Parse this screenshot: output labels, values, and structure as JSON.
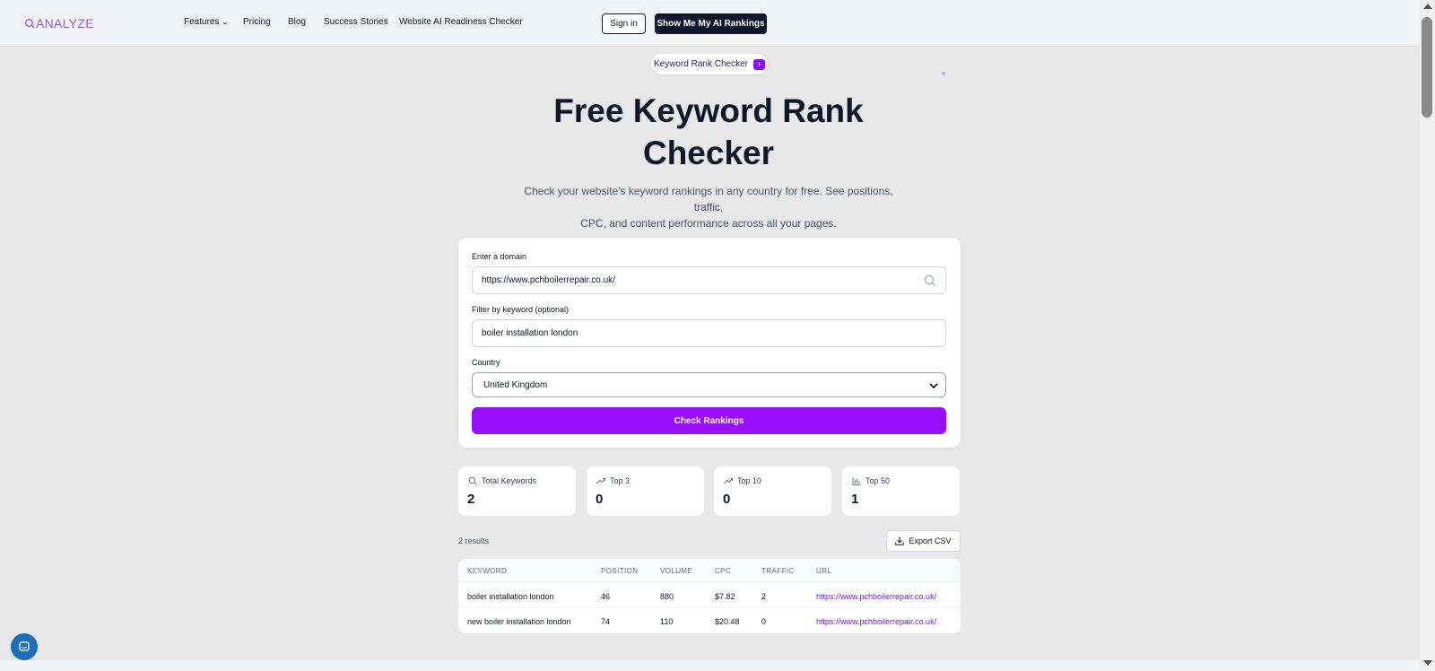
{
  "header": {
    "logo_text": "ANALYZE",
    "nav": {
      "features": "Features",
      "pricing": "Pricing",
      "blog": "Blog",
      "success_stories": "Success Stories",
      "readiness_checker": "Website AI Readiness Checker"
    },
    "sign_in": "Sign in",
    "cta": "Show Me My AI Rankings"
  },
  "hero": {
    "pill": "Keyword Rank Checker",
    "title_line1": "Free Keyword Rank",
    "title_line2": "Checker",
    "subtitle_line1": "Check your website's keyword rankings in any country for free. See positions, traffic,",
    "subtitle_line2": "CPC, and content performance across all your pages."
  },
  "form": {
    "domain_label": "Enter a domain",
    "domain_value": "https://www.pchboilerrepair.co.uk/",
    "keyword_label": "Filter by keyword (optional)",
    "keyword_value": "boiler installation london",
    "country_label": "Country",
    "country_value": "United Kingdom",
    "submit": "Check Rankings"
  },
  "stats": [
    {
      "label": "Total Keywords",
      "value": "2",
      "icon": "search-icon"
    },
    {
      "label": "Top 3",
      "value": "0",
      "icon": "trending-up-icon"
    },
    {
      "label": "Top 10",
      "value": "0",
      "icon": "trending-up-icon"
    },
    {
      "label": "Top 50",
      "value": "1",
      "icon": "bar-chart-icon"
    }
  ],
  "results": {
    "count": "2 results",
    "export": "Export CSV",
    "columns": [
      "KEYWORD",
      "POSITION",
      "VOLUME",
      "CPC",
      "TRAFFIC",
      "URL"
    ],
    "rows": [
      [
        "boiler installation london",
        "46",
        "880",
        "$7.82",
        "2",
        "https://www.pchboilerrepair.co.uk/"
      ],
      [
        "new boiler installation london",
        "74",
        "110",
        "$20.48",
        "0",
        "https://www.pchboilerrepair.co.uk/"
      ]
    ]
  },
  "colors": {
    "brand": "#8b5cf6",
    "primary_button": "#9810fa",
    "dark_button": "#0f172a",
    "link": "#7c0ef0",
    "chat_bubble": "#1a6fb8"
  }
}
